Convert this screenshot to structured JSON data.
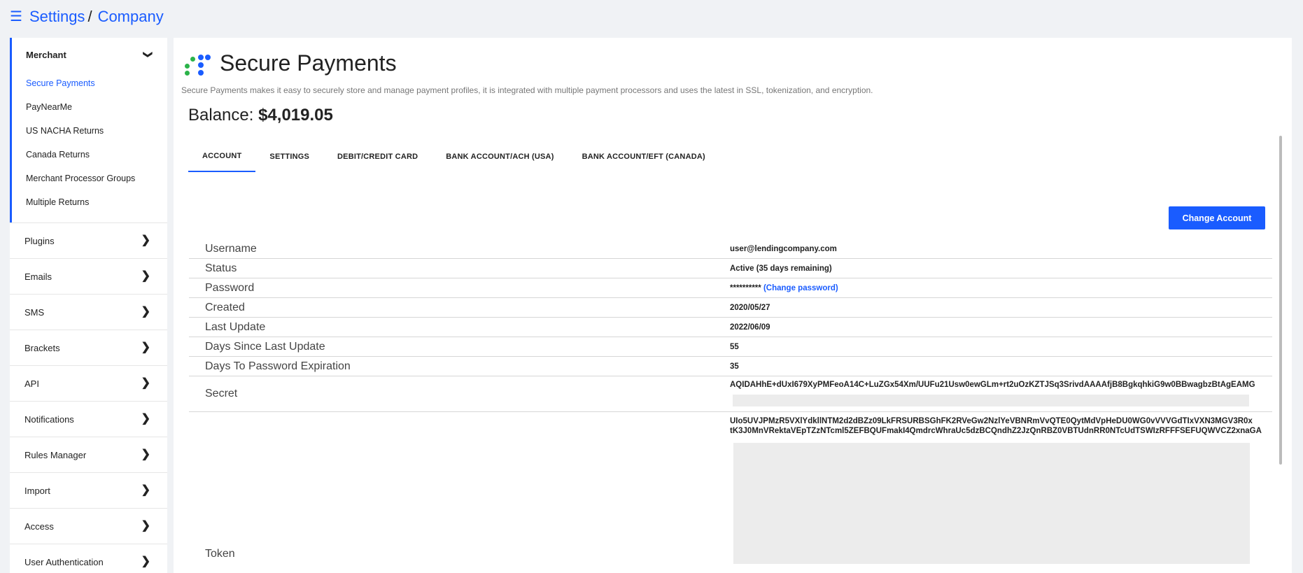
{
  "breadcrumb": {
    "root": "Settings",
    "separator": "/",
    "current": "Company"
  },
  "sidebar": {
    "merchant": {
      "label": "Merchant",
      "items": [
        {
          "label": "Secure Payments",
          "active": true
        },
        {
          "label": "PayNearMe"
        },
        {
          "label": "US NACHA Returns"
        },
        {
          "label": "Canada Returns"
        },
        {
          "label": "Merchant Processor Groups"
        },
        {
          "label": "Multiple Returns"
        }
      ]
    },
    "sections": [
      {
        "label": "Plugins"
      },
      {
        "label": "Emails"
      },
      {
        "label": "SMS"
      },
      {
        "label": "Brackets"
      },
      {
        "label": "API"
      },
      {
        "label": "Notifications"
      },
      {
        "label": "Rules Manager"
      },
      {
        "label": "Import"
      },
      {
        "label": "Access"
      },
      {
        "label": "User Authentication"
      }
    ]
  },
  "main": {
    "title": "Secure Payments",
    "description": "Secure Payments makes it easy to securely store and manage payment profiles, it is integrated with multiple payment processors and uses the latest in SSL, tokenization, and encryption.",
    "balance_label": "Balance:",
    "balance_value": "$4,019.05",
    "tabs": [
      {
        "label": "ACCOUNT",
        "active": true
      },
      {
        "label": "SETTINGS"
      },
      {
        "label": "DEBIT/CREDIT CARD"
      },
      {
        "label": "BANK ACCOUNT/ACH (USA)"
      },
      {
        "label": "BANK ACCOUNT/EFT (CANADA)"
      }
    ],
    "change_account_button": "Change Account",
    "fields": {
      "username": {
        "label": "Username",
        "value": "user@lendingcompany.com"
      },
      "status": {
        "label": "Status",
        "value": "Active (35 days remaining)"
      },
      "password": {
        "label": "Password",
        "value": "**********",
        "link": "(Change password)"
      },
      "created": {
        "label": "Created",
        "value": "2020/05/27"
      },
      "last_update": {
        "label": "Last Update",
        "value": "2022/06/09"
      },
      "days_since": {
        "label": "Days Since Last Update",
        "value": "55"
      },
      "days_to_expiry": {
        "label": "Days To Password Expiration",
        "value": "35"
      },
      "secret": {
        "label": "Secret",
        "value": "AQIDAHhE+dUxI679XyPMFeoA14C+LuZGx54Xm/UUFu21Usw0ewGLm+rt2uOzKZTJSq3SrivdAAAAfjB8BgkqhkiG9w0BBwagbzBtAgEAMG"
      },
      "token": {
        "label": "Token",
        "line1": "UIo5UVJPMzR5VXlYdkllNTM2d2dBZz09LkFRSURBSGhFK2RVeGw2NzlYeVBNRmVvQTE0QytMdVpHeDU0WG0vVVVGdTIxVXN3MGV3R0x",
        "line2": "tK3J0MnVRektaVEpTZzNTcml5ZEFBQUFmakI4QmdrcWhraUc5dzBCQndhZ2JzQnRBZ0VBTUdnRR0NTcUdTSWIzRFFFSEFUQWVCZ2xnaGA"
      }
    }
  },
  "colors": {
    "accent": "#1a5cff",
    "logo_green": "#2bb34a",
    "logo_blue": "#1a5cff"
  }
}
